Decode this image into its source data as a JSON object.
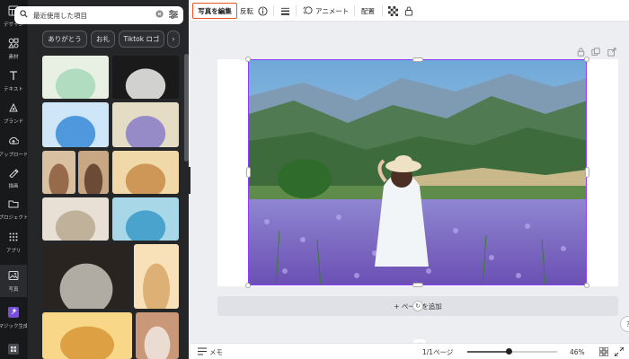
{
  "rail": [
    {
      "label": "デザイン",
      "icon": "layout-icon"
    },
    {
      "label": "素材",
      "icon": "elements-icon"
    },
    {
      "label": "テキスト",
      "icon": "text-icon"
    },
    {
      "label": "ブランド",
      "icon": "brand-icon"
    },
    {
      "label": "アップロード",
      "icon": "upload-icon"
    },
    {
      "label": "描画",
      "icon": "draw-icon"
    },
    {
      "label": "プロジェクト",
      "icon": "folder-icon"
    },
    {
      "label": "アプリ",
      "icon": "apps-icon"
    },
    {
      "label": "写真",
      "icon": "photo-icon"
    },
    {
      "label": "マジック生成",
      "icon": "magic-icon"
    }
  ],
  "search": {
    "value": "最近使用した項目"
  },
  "chips": [
    "ありがとう",
    "お礼",
    "Tiktok ロゴ"
  ],
  "toolbar": {
    "edit_photo": "写真を編集",
    "flip": "反転",
    "animate": "アニメート",
    "position": "配置"
  },
  "canvas": {
    "add_page": "+ ページを追加"
  },
  "bottom": {
    "notes": "メモ",
    "page_count": "1/1ページ",
    "zoom": "46%",
    "zoom_level": 0.46
  },
  "colors": {
    "accent_purple": "#8b3dff",
    "edit_button_border": "#e8542e",
    "panel_bg": "#252627",
    "rail_bg": "#18191b"
  }
}
